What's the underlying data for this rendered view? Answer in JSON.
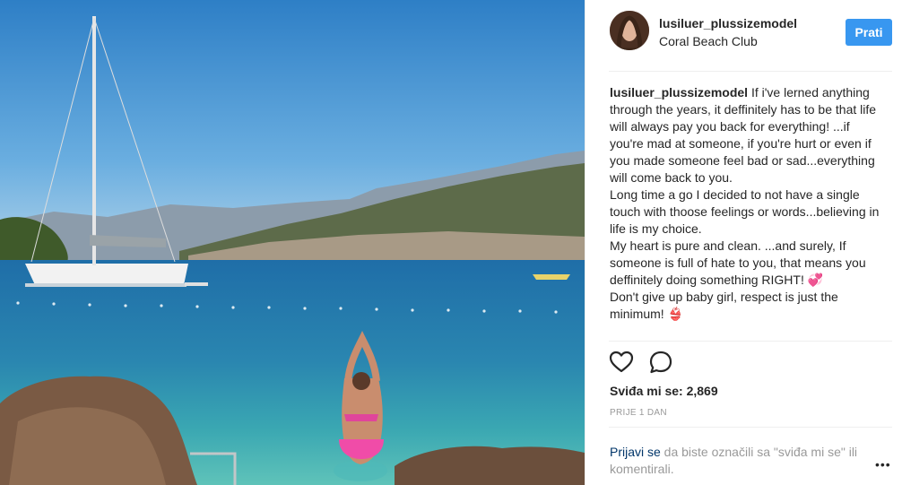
{
  "post": {
    "username": "lusiluer_plussizemodel",
    "location": "Coral Beach Club",
    "follow_label": "Prati",
    "caption_author": "lusiluer_plussizemodel",
    "caption_lines": [
      "If i've lerned anything through the years, it deffinitely has to be that life will always pay you back for everything! ...if you're mad at someone, if you're hurt or even if you made someone feel bad or sad...everything will come back to you.",
      "Long time a go I decided to not have a single touch with thoose feelings or words...believing in life is my choice.",
      "My heart is pure and clean. ...and surely, If someone is full of hate to you, that means you deffinitely doing something RIGHT! 💞",
      "Don't give up baby girl, respect is just the minimum! 👙"
    ],
    "likes_label": "Sviđa mi se:",
    "likes_count": "2,869",
    "time_ago": "PRIJE 1 DAN",
    "login_link": "Prijavi se",
    "login_text": " da biste označili sa \"sviđa mi se\" ili komentirali.",
    "more_label": "•••"
  },
  "icons": {
    "like": "heart-icon",
    "comment": "comment-bubble-icon",
    "more": "more-options-icon"
  },
  "colors": {
    "follow_button": "#3897f0",
    "link": "#003569",
    "muted": "#999999"
  }
}
